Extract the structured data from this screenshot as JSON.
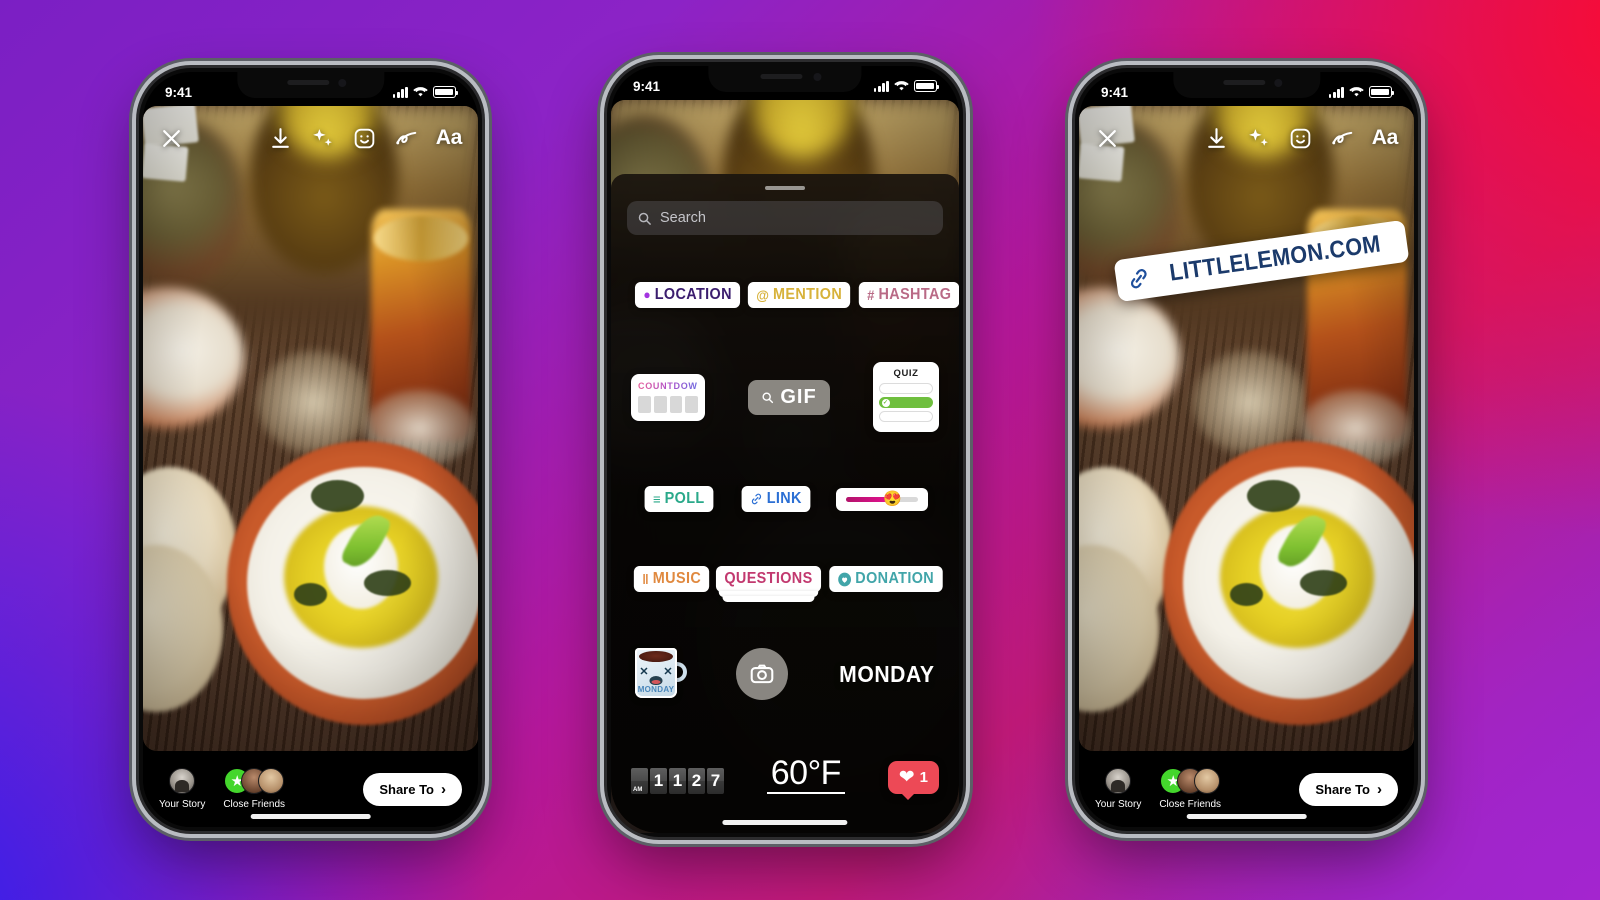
{
  "background": {
    "colors": [
      "#7b1fc4",
      "#fa0b32",
      "#2f1ff0",
      "#a425cf"
    ]
  },
  "status_bar": {
    "time": "9:41",
    "signal": "signal-bars",
    "wifi": "wifi",
    "battery": "battery-full"
  },
  "toolbar": {
    "close_label": "✕",
    "icons": [
      {
        "name": "download-icon",
        "label": "Save"
      },
      {
        "name": "sparkles-icon",
        "label": "Effects"
      },
      {
        "name": "sticker-icon",
        "label": "Stickers"
      },
      {
        "name": "draw-icon",
        "label": "Draw"
      },
      {
        "name": "text-icon",
        "label": "Aa"
      }
    ],
    "text_tool_label": "Aa"
  },
  "story_footer": {
    "your_story_label": "Your Story",
    "close_friends_label": "Close Friends",
    "share_to_label": "Share To",
    "share_to_chevron": "›"
  },
  "link_sticker": {
    "text": "LITTLELEMON.COM",
    "icon": "link-icon",
    "color": "#1b3a6b"
  },
  "tray": {
    "search": {
      "placeholder": "Search",
      "icon": "search-icon"
    },
    "grabber": "drag-handle",
    "row1": [
      {
        "id": "location",
        "label": "LOCATION",
        "glyph": "⊙",
        "color": "#3b1d6e",
        "accent": "#a335e0"
      },
      {
        "id": "mention",
        "label": "MENTION",
        "glyph": "@",
        "color": "#d7b23a"
      },
      {
        "id": "hashtag",
        "label": "HASHTAG",
        "glyph": "#",
        "color": "#b96a86"
      }
    ],
    "row2": {
      "countdown": {
        "title": "COUNTDOWN",
        "boxes": 4
      },
      "gif": {
        "label": "GIF",
        "icon": "search-icon"
      },
      "quiz": {
        "title": "QUIZ",
        "options": 3,
        "selected_index": 1,
        "selected_color": "#6fbf3e"
      }
    },
    "row3": [
      {
        "id": "poll",
        "label": "POLL",
        "glyph": "≡",
        "color": "#2aa98a"
      },
      {
        "id": "link",
        "label": "LINK",
        "glyph": "link-icon",
        "color": "#2b6fd4"
      },
      {
        "id": "emoji-slider",
        "label": "",
        "emoji": "😍",
        "fill_percent": 58,
        "fill_color": "#e0128e"
      }
    ],
    "row4": [
      {
        "id": "music",
        "label": "MUSIC",
        "glyph": "‖",
        "color": "#e0893f"
      },
      {
        "id": "questions",
        "label": "QUESTIONS",
        "glyph": "",
        "color": "#c2396f"
      },
      {
        "id": "donation",
        "label": "DONATION",
        "glyph": "♥",
        "color": "#41a5a9"
      }
    ],
    "row5": {
      "mug_sticker": {
        "label": "MONDAY",
        "eye_left": "✕",
        "eye_right": "✕"
      },
      "camera_button": "camera-icon",
      "monday_text": "MONDAY"
    },
    "row6": {
      "clock": {
        "meridiem": "AM",
        "digits": [
          "1",
          "1",
          "2",
          "7"
        ]
      },
      "weather": {
        "value": "60°F"
      },
      "like": {
        "count": "1",
        "icon": "heart-icon",
        "color": "#ed4956"
      }
    }
  }
}
